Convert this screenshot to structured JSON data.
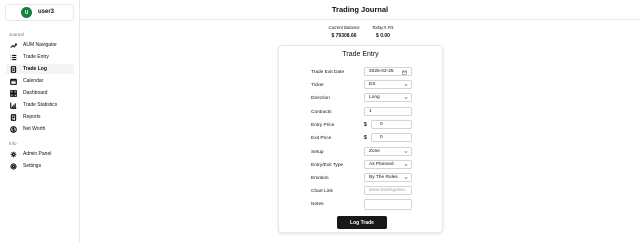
{
  "user": {
    "initial": "U",
    "name": "user3"
  },
  "sidebar": {
    "section_journal": "Journal",
    "section_info": "Info",
    "items": [
      {
        "label": "AUM Navigator",
        "icon": "trending-up-icon"
      },
      {
        "label": "Trade Entry",
        "icon": "list-icon"
      },
      {
        "label": "Trade Log",
        "icon": "file-text-icon"
      },
      {
        "label": "Calendar",
        "icon": "calendar-icon"
      },
      {
        "label": "Dashboard",
        "icon": "grid-icon"
      },
      {
        "label": "Trade Statistics",
        "icon": "bar-chart-icon"
      },
      {
        "label": "Reports",
        "icon": "report-icon"
      },
      {
        "label": "Net Worth",
        "icon": "dollar-circle-icon"
      }
    ],
    "info_items": [
      {
        "label": "Admin Panel",
        "icon": "admin-icon"
      },
      {
        "label": "Settings",
        "icon": "gear-icon"
      }
    ]
  },
  "header": {
    "title": "Trading Journal"
  },
  "stats": {
    "balance_label": "Current Balance",
    "balance_value": "$ 79308.66",
    "pnl_label": "Today's P/L",
    "pnl_value": "$ 0.00"
  },
  "form": {
    "title": "Trade Entry",
    "exit_date_label": "Trade Exit Date",
    "exit_date_value": "2025-03-25",
    "ticker_label": "Ticker",
    "ticker_value": "ES",
    "direction_label": "Direction",
    "direction_value": "Long",
    "contracts_label": "Contracts",
    "contracts_value": "1",
    "entry_price_label": "Entry Price",
    "entry_price_value": "0",
    "exit_price_label": "Exit Price",
    "exit_price_value": "0",
    "currency_symbol": "$",
    "setup_label": "Setup",
    "setup_value": "Zone",
    "entry_exit_type_label": "Entry/Exit Type",
    "entry_exit_type_value": "As Planned",
    "emotion_label": "Emotion",
    "emotion_value": "By The Rules",
    "chart_link_label": "Chart Link",
    "chart_link_placeholder": "www.tradingview.",
    "notes_label": "Notes",
    "notes_value": "",
    "submit_label": "Log Trade"
  },
  "colors": {
    "avatar": "#15803d",
    "button": "#18181b",
    "active_nav": "#f3f4f6"
  }
}
